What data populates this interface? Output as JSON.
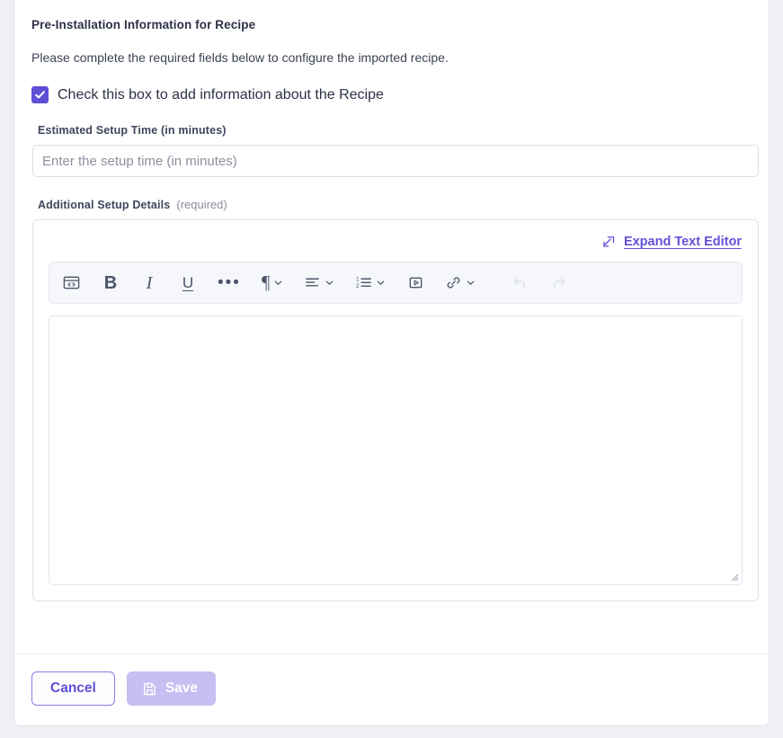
{
  "panel": {
    "title": "Pre-Installation Information for Recipe",
    "description": "Please complete the required fields below to configure the imported recipe."
  },
  "checkbox": {
    "label": "Check this box to add information about the Recipe",
    "checked": "true",
    "accent_color": "#5d4fd6",
    "check_icon": "check-icon"
  },
  "fields": {
    "setup_time": {
      "label": "Estimated Setup Time (in minutes)",
      "placeholder": "Enter the setup time (in minutes)",
      "value": ""
    },
    "additional_details": {
      "label": "Additional Setup Details",
      "required_note": "(required)",
      "value": ""
    }
  },
  "editor": {
    "expand_link": {
      "label": "Expand Text Editor",
      "icon": "expand-arrow-icon",
      "color": "#6151d9"
    },
    "toolbar": [
      {
        "name": "source-code-icon",
        "label": "",
        "type": "icon",
        "chevron": "false",
        "disabled": "false"
      },
      {
        "name": "bold-icon",
        "label": "B",
        "type": "bold",
        "chevron": "false",
        "disabled": "false"
      },
      {
        "name": "italic-icon",
        "label": "I",
        "type": "italic",
        "chevron": "false",
        "disabled": "false"
      },
      {
        "name": "underline-icon",
        "label": "U",
        "type": "under",
        "chevron": "false",
        "disabled": "false"
      },
      {
        "name": "more-options-icon",
        "label": "•••",
        "type": "dots",
        "chevron": "false",
        "disabled": "false"
      },
      {
        "name": "paragraph-icon",
        "label": "¶",
        "type": "glyph",
        "chevron": "true",
        "disabled": "false"
      },
      {
        "name": "align-left-icon",
        "label": "",
        "type": "icon",
        "chevron": "true",
        "disabled": "false"
      },
      {
        "name": "numbered-list-icon",
        "label": "",
        "type": "icon",
        "chevron": "true",
        "disabled": "false"
      },
      {
        "name": "insert-media-icon",
        "label": "",
        "type": "icon",
        "chevron": "false",
        "disabled": "false"
      },
      {
        "name": "link-icon",
        "label": "",
        "type": "icon",
        "chevron": "true",
        "disabled": "false"
      },
      {
        "name": "undo-icon",
        "label": "",
        "type": "icon",
        "chevron": "false",
        "disabled": "true"
      },
      {
        "name": "redo-icon",
        "label": "",
        "type": "icon",
        "chevron": "false",
        "disabled": "true"
      }
    ],
    "toolbar_background": "#f5f7fa",
    "resize_handle": "resize-handle-icon"
  },
  "footer": {
    "cancel_label": "Cancel",
    "save_label": "Save",
    "save_icon": "save-disk-icon",
    "save_disabled": "true",
    "cancel_color": "#5d4fd6",
    "save_background": "#c5bff2"
  }
}
